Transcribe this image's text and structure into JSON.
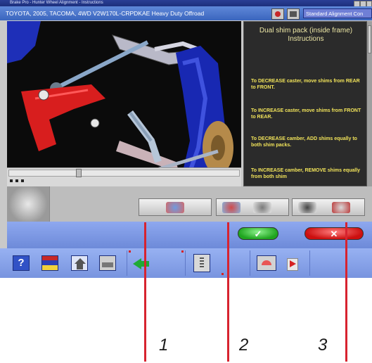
{
  "titlebar": {
    "title": "Brake Pro - Hunter Wheel Alignment - Instructions"
  },
  "infobar": {
    "vehicle": "TOYOTA, 2005, TACOMA, 4WD V2W170L-CRPDKAE Heavy Duty Offroad",
    "mode": "Standard Alignment Con"
  },
  "instructions": {
    "heading": "Dual shim pack (inside frame) Instructions",
    "items": [
      "To DECREASE caster, move shims from REAR to FRONT.",
      "To INCREASE caster, move shims from FRONT to REAR.",
      "To DECREASE camber, ADD shims equally to both shim packs.",
      "To INCREASE camber, REMOVE shims equally from both shim"
    ]
  },
  "actions": {
    "ok": "✓",
    "cancel": "✕"
  },
  "toolbar": {
    "help": "?"
  },
  "callouts": [
    "1",
    "2",
    "3"
  ],
  "colors": {
    "window_blue": "#6d8ad9",
    "instruction_text": "#f2e45a",
    "ok_green": "#1fa51f",
    "cancel_red": "#cc0f0f",
    "callout_red": "#d7232f"
  },
  "icons": {
    "help": "help-book-icon",
    "specs": "specifications-icon",
    "home": "home-icon",
    "print": "print-icon",
    "back": "back-arrow-icon",
    "doc": "document-icon",
    "gauge": "gauge-icon",
    "next": "next-page-icon"
  }
}
